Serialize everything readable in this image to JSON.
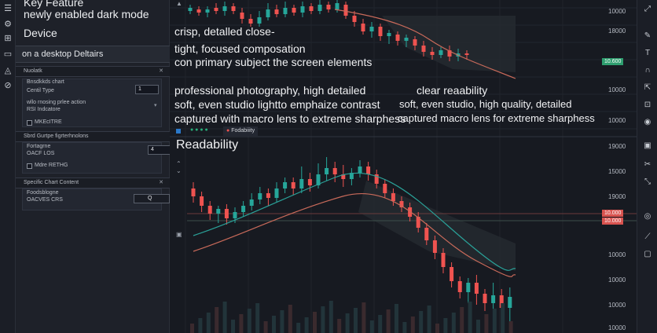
{
  "panel": {
    "key_feature": "Key Feature",
    "dark_mode": "newly enabled dark mode",
    "device": "Device",
    "desktop_details": "on a desktop Deltairs",
    "section_nuolatk": "Nuolatk",
    "chart_heading": "Bnsdkkds chart",
    "centil_type": "Centil Type",
    "centil_value": "1",
    "rsi_line1": "wllo rnosing prlee action",
    "rsi_line2": "RSI Indcatore",
    "mkeritre": "MKEcITRE",
    "section_sbrd": "Sbrd Gurtpe figrterhnolons",
    "fortagrne": "Fortagrne",
    "oacf": "OACF LOS",
    "oacf_value": "4",
    "mdre": "Mdre RETHG",
    "section_specific": "Specific Chart Content",
    "foodsblogne": "Foodsblogne",
    "oacvs": "OACVES CRS",
    "oacvs_value": "Q"
  },
  "overlay": {
    "line1": "crisp, detalled close-",
    "line2": "tight, focused composation",
    "line3": "con primary subject the screen elements",
    "line4": "professional photography, high detailed",
    "line5": "soft, even studio lightto emphaize contrast",
    "line6": "captured with macro lens to extreme sharphess",
    "line7": "clear reaability",
    "line8": "soft, even studio, high quality, detailed",
    "line9": "captured macro lens for extreme sharphess",
    "readability": "Readability",
    "legend_label": "Fodabiiity"
  },
  "axis": {
    "top": [
      "10000",
      "18000",
      "10000",
      "10000",
      "10000"
    ],
    "top_tag": "10.600",
    "bottom": [
      "19000",
      "15000",
      "19000",
      "10000",
      "10000",
      "10000",
      "19000",
      "10000"
    ],
    "bottom_tag1": "10.000",
    "bottom_tag2": "10.000"
  },
  "colors": {
    "up": "#26a69a",
    "down": "#ef5350",
    "panel_bg": "#1e2129",
    "chart_bg": "#171a21",
    "tag_green": "#2e9e6f",
    "tag_red": "#d9534f"
  },
  "icons": {
    "left_rail": [
      "menu-icon",
      "gear-icon",
      "layout-icon",
      "square-icon",
      "drop-icon",
      "link-icon"
    ],
    "right_rail": [
      "expand-icon",
      "pencil-icon",
      "text-icon",
      "magnet-icon",
      "arrow-icon",
      "lock-icon",
      "eye-icon",
      "camera-icon",
      "scissors-icon",
      "brush-icon",
      "target-icon",
      "trash-icon"
    ]
  }
}
